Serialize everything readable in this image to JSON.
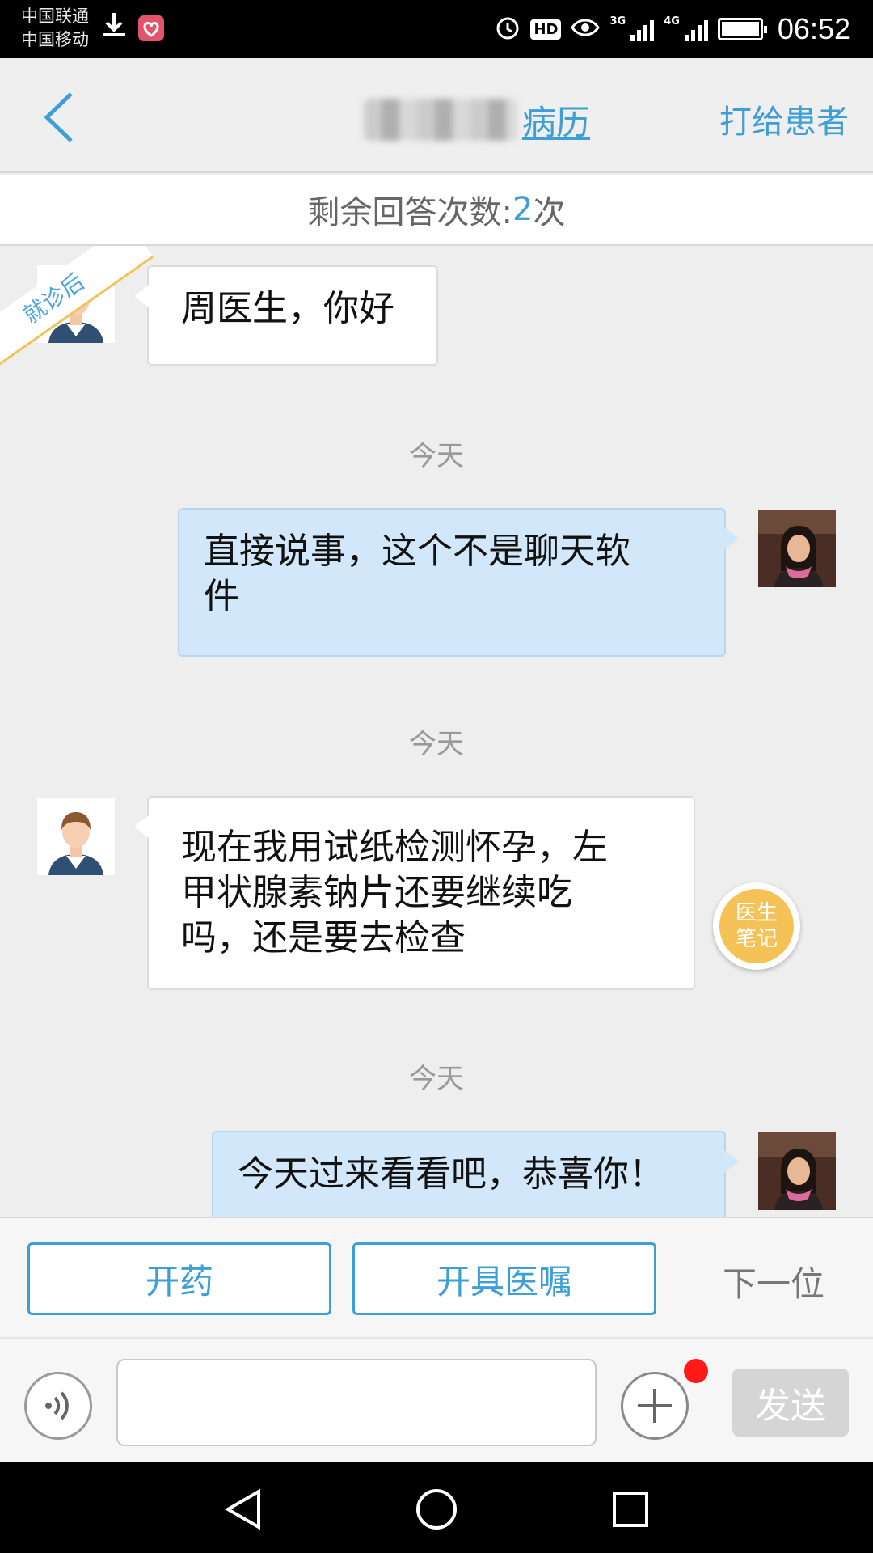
{
  "status_bar": {
    "carrier_1": "中国联通",
    "carrier_2": "中国移动",
    "hd_label": "HD",
    "network_1": "3G",
    "network_2": "4G",
    "time": "06:52"
  },
  "header": {
    "record_link": "病历",
    "call_button": "打给患者"
  },
  "remaining": {
    "label": "剩余回答次数:",
    "count": "2",
    "unit": "次"
  },
  "chat": {
    "ribbon": "就诊后",
    "messages": [
      {
        "side": "left",
        "text": "周医生，你好"
      },
      {
        "time": "今天"
      },
      {
        "side": "right",
        "line1": "直接说事，这个不是聊天软",
        "line2": "件"
      },
      {
        "time": "今天"
      },
      {
        "side": "left",
        "line1": "现在我用试纸检测怀孕，左",
        "line2": "甲状腺素钠片还要继续吃",
        "line3": "吗，还是要去检查"
      },
      {
        "time": "今天"
      },
      {
        "side": "right",
        "text": "今天过来看看吧，恭喜你！"
      }
    ],
    "notes_button": {
      "line1": "医生",
      "line2": "笔记"
    }
  },
  "actions": {
    "prescribe": "开药",
    "advice": "开具医嘱",
    "next": "下一位"
  },
  "input": {
    "value": "",
    "send": "发送"
  },
  "colors": {
    "accent": "#3e9ed6",
    "bubble_right": "#d2e8fa",
    "notes": "#f4c256",
    "badge": "#ff1a1a"
  }
}
